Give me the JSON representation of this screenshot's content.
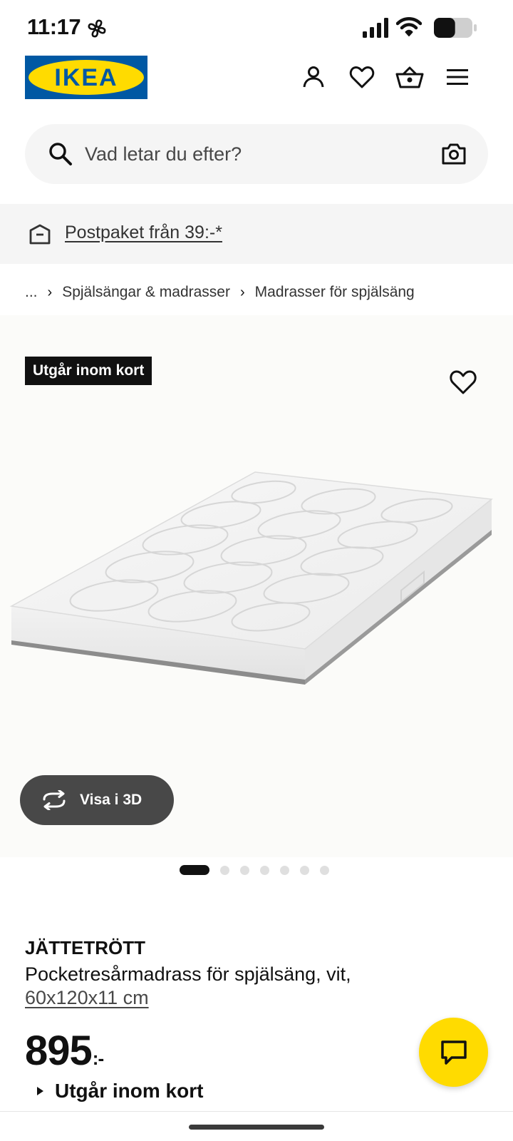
{
  "status_bar": {
    "time": "11:17",
    "battery_level": 0.55
  },
  "header": {
    "logo_text": "IKEA",
    "icons": [
      "user-icon",
      "heart-icon",
      "cart-icon",
      "menu-icon"
    ]
  },
  "search": {
    "placeholder": "Vad letar du efter?",
    "value": ""
  },
  "banner": {
    "text": "Postpaket från 39:-*"
  },
  "breadcrumb": {
    "ellipsis": "...",
    "items": [
      "Spjälsängar & madrasser",
      "Madrasser för spjälsäng"
    ]
  },
  "product": {
    "badge": "Utgår inom kort",
    "view3d_label": "Visa i 3D",
    "carousel": {
      "count": 7,
      "active_index": 0
    },
    "name": "JÄTTETRÖTT",
    "description": "Pocketresårmadrass för spjälsäng, vit,",
    "size": "60x120x11 cm",
    "price": "895",
    "price_suffix": ":-",
    "stock_status": "Utgår inom kort"
  },
  "colors": {
    "ikea_blue": "#0058a3",
    "ikea_yellow": "#ffdb00",
    "text": "#111111",
    "surface": "#f5f5f5"
  }
}
